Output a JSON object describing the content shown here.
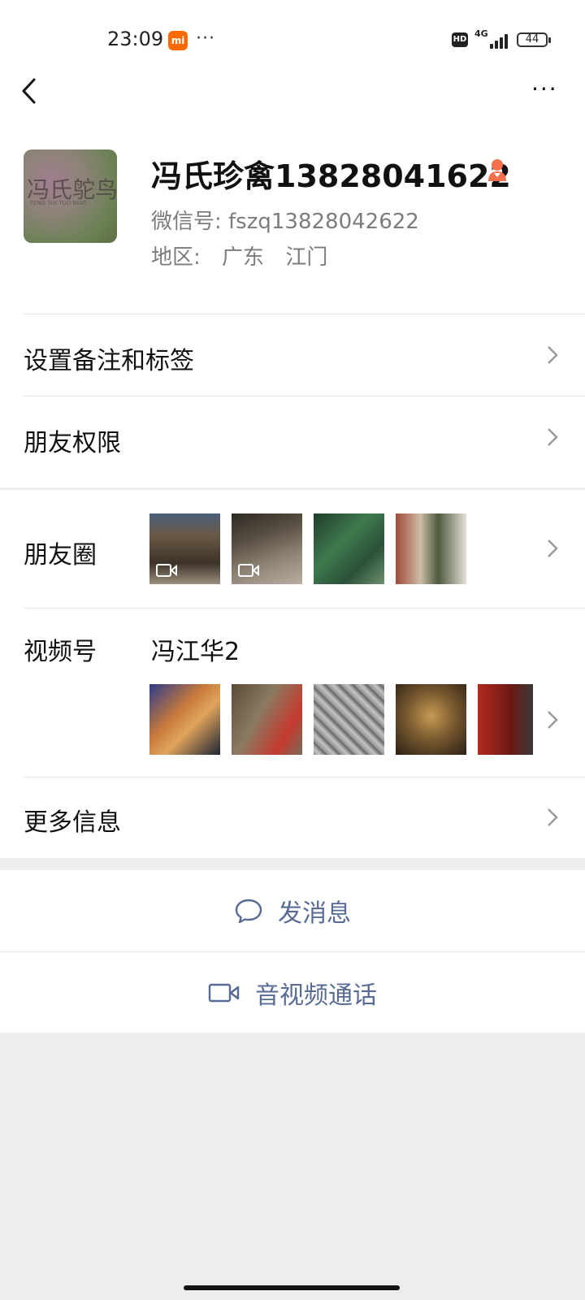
{
  "status_bar": {
    "time": "23:09",
    "mi_badge": "mi",
    "overflow": "···",
    "hd": "HD",
    "network": "4G",
    "battery": "44"
  },
  "nav": {
    "back_icon": "chevron-left-icon",
    "more": "···"
  },
  "profile": {
    "avatar_text": "冯氏鸵鸟",
    "avatar_subtext": "FENG SHI TUO NIAO",
    "name": "冯氏珍禽13828041622",
    "gender_icon": "female-user-icon",
    "wechat_id": "微信号:  fszq13828042622",
    "region_label": "地区:",
    "region_province": "广东",
    "region_city": "江门"
  },
  "rows": {
    "remarks": "设置备注和标签",
    "permissions": "朋友权限",
    "moments": "朋友圈",
    "channels": "视频号",
    "channels_name": "冯江华2",
    "more_info": "更多信息"
  },
  "actions": {
    "message": "发消息",
    "call": "音视频通话"
  },
  "colors": {
    "link": "#576b95",
    "accent_female": "#f5704b",
    "mi_orange": "#ff6a00",
    "page_bg": "#ededed"
  }
}
